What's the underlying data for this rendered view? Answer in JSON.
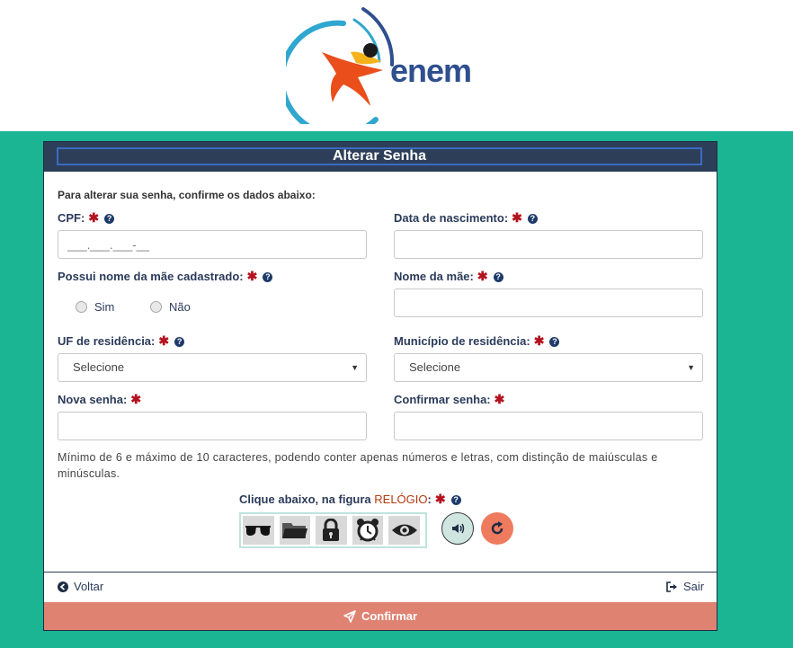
{
  "brand": {
    "logo_text": "enem"
  },
  "form": {
    "title": "Alterar Senha",
    "intro": "Para alterar sua senha, confirme os dados abaixo:",
    "required_mark": "✱",
    "help_mark": "?",
    "cpf": {
      "label": "CPF:",
      "placeholder": "___.___.___-__"
    },
    "birth": {
      "label": "Data de nascimento:",
      "placeholder": ""
    },
    "mother_registered": {
      "label": "Possui nome da mãe cadastrado:",
      "options": [
        "Sim",
        "Não"
      ]
    },
    "mother_name": {
      "label": "Nome da mãe:",
      "placeholder": ""
    },
    "uf": {
      "label": "UF de residência:",
      "selected": "Selecione"
    },
    "municipio": {
      "label": "Município de residência:",
      "selected": "Selecione"
    },
    "new_password": {
      "label": "Nova senha:"
    },
    "confirm_password": {
      "label": "Confirmar senha:"
    },
    "password_hint": "Mínimo de 6 e máximo de 10 caracteres, podendo conter apenas números e letras, com distinção de maiúsculas e minúsculas.",
    "captcha": {
      "label_prefix": "Clique abaixo, na figura",
      "target": "RELÓGIO",
      "suffix": ":",
      "icons": [
        "glasses-icon",
        "folder-icon",
        "lock-icon",
        "alarm-clock-icon",
        "eye-icon"
      ]
    }
  },
  "footer": {
    "back_label": "Voltar",
    "exit_label": "Sair",
    "confirm_label": "Confirmar"
  },
  "colors": {
    "background": "#1bb594",
    "header": "#2d3f58",
    "confirm": "#e08272",
    "required": "#b3121e"
  }
}
